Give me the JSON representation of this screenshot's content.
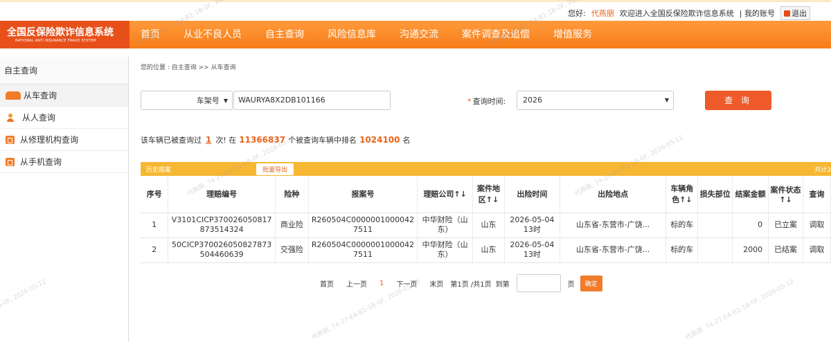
{
  "header": {
    "greeting": "您好:",
    "username": "代燕朋",
    "welcome": "欢迎进入全国反保险欺诈信息系统",
    "account_link": "| 我的账号",
    "logout_label": "退出"
  },
  "logo": {
    "cn": "全国反保险欺诈信息系统",
    "en": "NATIONAL ANTI INSURANCE FRAUD SYSTEM"
  },
  "nav": {
    "items": [
      "首页",
      "从业不良人员",
      "自主查询",
      "风险信息库",
      "沟通交流",
      "案件调查及追偿",
      "增值服务"
    ]
  },
  "sidebar": {
    "title": "自主查询",
    "items": [
      {
        "label": "从车查询",
        "icon": "car-icon"
      },
      {
        "label": "从人查询",
        "icon": "person-icon"
      },
      {
        "label": "从修理机构查询",
        "icon": "repair-shop-icon"
      },
      {
        "label": "从手机查询",
        "icon": "phone-icon"
      }
    ]
  },
  "breadcrumb": {
    "prefix": "您的位置 : ",
    "level1": "自主查询",
    "sep": " >> ",
    "level2": "从车查询"
  },
  "search": {
    "type_selected": "车架号",
    "vin_value": "WAURYA8X2DB101166",
    "time_label": "查询时间:",
    "time_required_mark": "*",
    "time_selected": "2026",
    "search_button": "查 询"
  },
  "stats": {
    "text1": "该车辆已被查询过",
    "times": "1",
    "text2": "次! 在",
    "total_vehicles": "11366837",
    "text3": "个被查询车辆中排名",
    "rank": "1024100",
    "text4": "名"
  },
  "history": {
    "title": "历史赔案",
    "export_button": "批量导出",
    "total_label": "共计2"
  },
  "table": {
    "headers": [
      "序号",
      "理赔编号",
      "险种",
      "报案号",
      "理赔公司↑↓",
      "案件地区↑↓",
      "出险时间",
      "出险地点",
      "车辆角色↑↓",
      "损失部位",
      "结案金额",
      "案件状态↑↓",
      "查询"
    ],
    "rows": [
      [
        "1",
        "V3101CICP370026050817873514324",
        "商业险",
        "R260504C00000010000427511",
        "中华财险（山东）",
        "山东",
        "2026-05-04 13时",
        "山东省-东营市-广饶...",
        "标的车",
        "",
        "0",
        "已立案",
        "调取"
      ],
      [
        "2",
        "50CICP370026050827873504460639",
        "交强险",
        "R260504C00000010000427511",
        "中华财险（山东）",
        "山东",
        "2026-05-04 13时",
        "山东省-东营市-广饶...",
        "标的车",
        "",
        "2000",
        "已结案",
        "调取"
      ]
    ]
  },
  "pager": {
    "first": "首页",
    "prev": "上一页",
    "current": "1",
    "next": "下一页",
    "last": "末页",
    "info": "第1页 /共1页",
    "goto": "到第",
    "page_unit": "页",
    "ok": "确定"
  },
  "watermark": "代燕朋, 74-27-EA-B1-1B-0F, 2026-05-12",
  "colors": {
    "brand_orange": "#f77d1a",
    "logo_red": "#e8501a",
    "accent": "#e8641b",
    "history_bar": "#f7b733"
  }
}
